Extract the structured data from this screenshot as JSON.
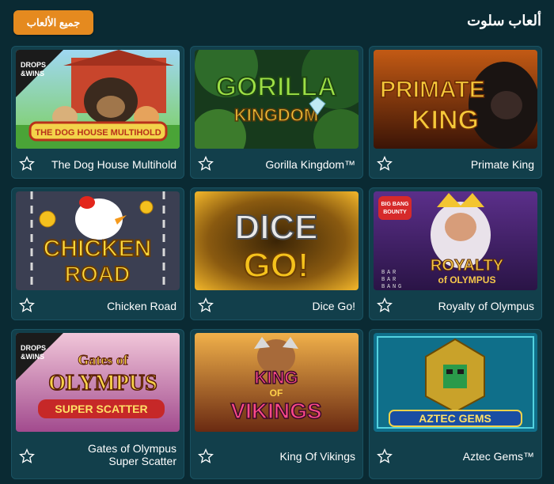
{
  "header": {
    "title": "ألعاب سلوت",
    "all_games_label": "جميع الألعاب"
  },
  "games": [
    {
      "title": "The Dog House Multihold",
      "art_text": [
        "THE DOG HOUSE MULTIHOLD"
      ],
      "badge": [
        "DROPS",
        "&WINS"
      ]
    },
    {
      "title": "Gorilla Kingdom™",
      "art_text": [
        "GORILLA",
        "KINGDOM"
      ]
    },
    {
      "title": "Primate King",
      "art_text": [
        "PRIMATE",
        "KING"
      ]
    },
    {
      "title": "Chicken Road",
      "art_text": [
        "CHICKEN",
        "ROAD"
      ]
    },
    {
      "title": "Dice Go!",
      "art_text": [
        "DICE",
        "GO!"
      ]
    },
    {
      "title": "Royalty of Olympus",
      "art_text": [
        "ROYALTY",
        "of OLYMPUS"
      ],
      "badge": [
        "BIG BANG",
        "BOUNTY"
      ],
      "grid_text": [
        "B",
        "A",
        "R",
        "B",
        "A",
        "R",
        "B",
        "A",
        "N",
        "G"
      ]
    },
    {
      "title": "Gates of Olympus Super Scatter",
      "art_text": [
        "Gates of",
        "OLYMPUS",
        "SUPER SCATTER"
      ],
      "badge": [
        "DROPS",
        "&WINS"
      ]
    },
    {
      "title": "King Of Vikings",
      "art_text": [
        "KING",
        "OF",
        "VIKINGS"
      ]
    },
    {
      "title": "Aztec Gems™",
      "art_text": [
        "AZTEC GEMS"
      ]
    }
  ],
  "colors": {
    "background": "#0a2a33",
    "card": "#123f4b",
    "accent": "#e58a1f"
  },
  "icons": {
    "favorite": "star-outline-icon"
  }
}
